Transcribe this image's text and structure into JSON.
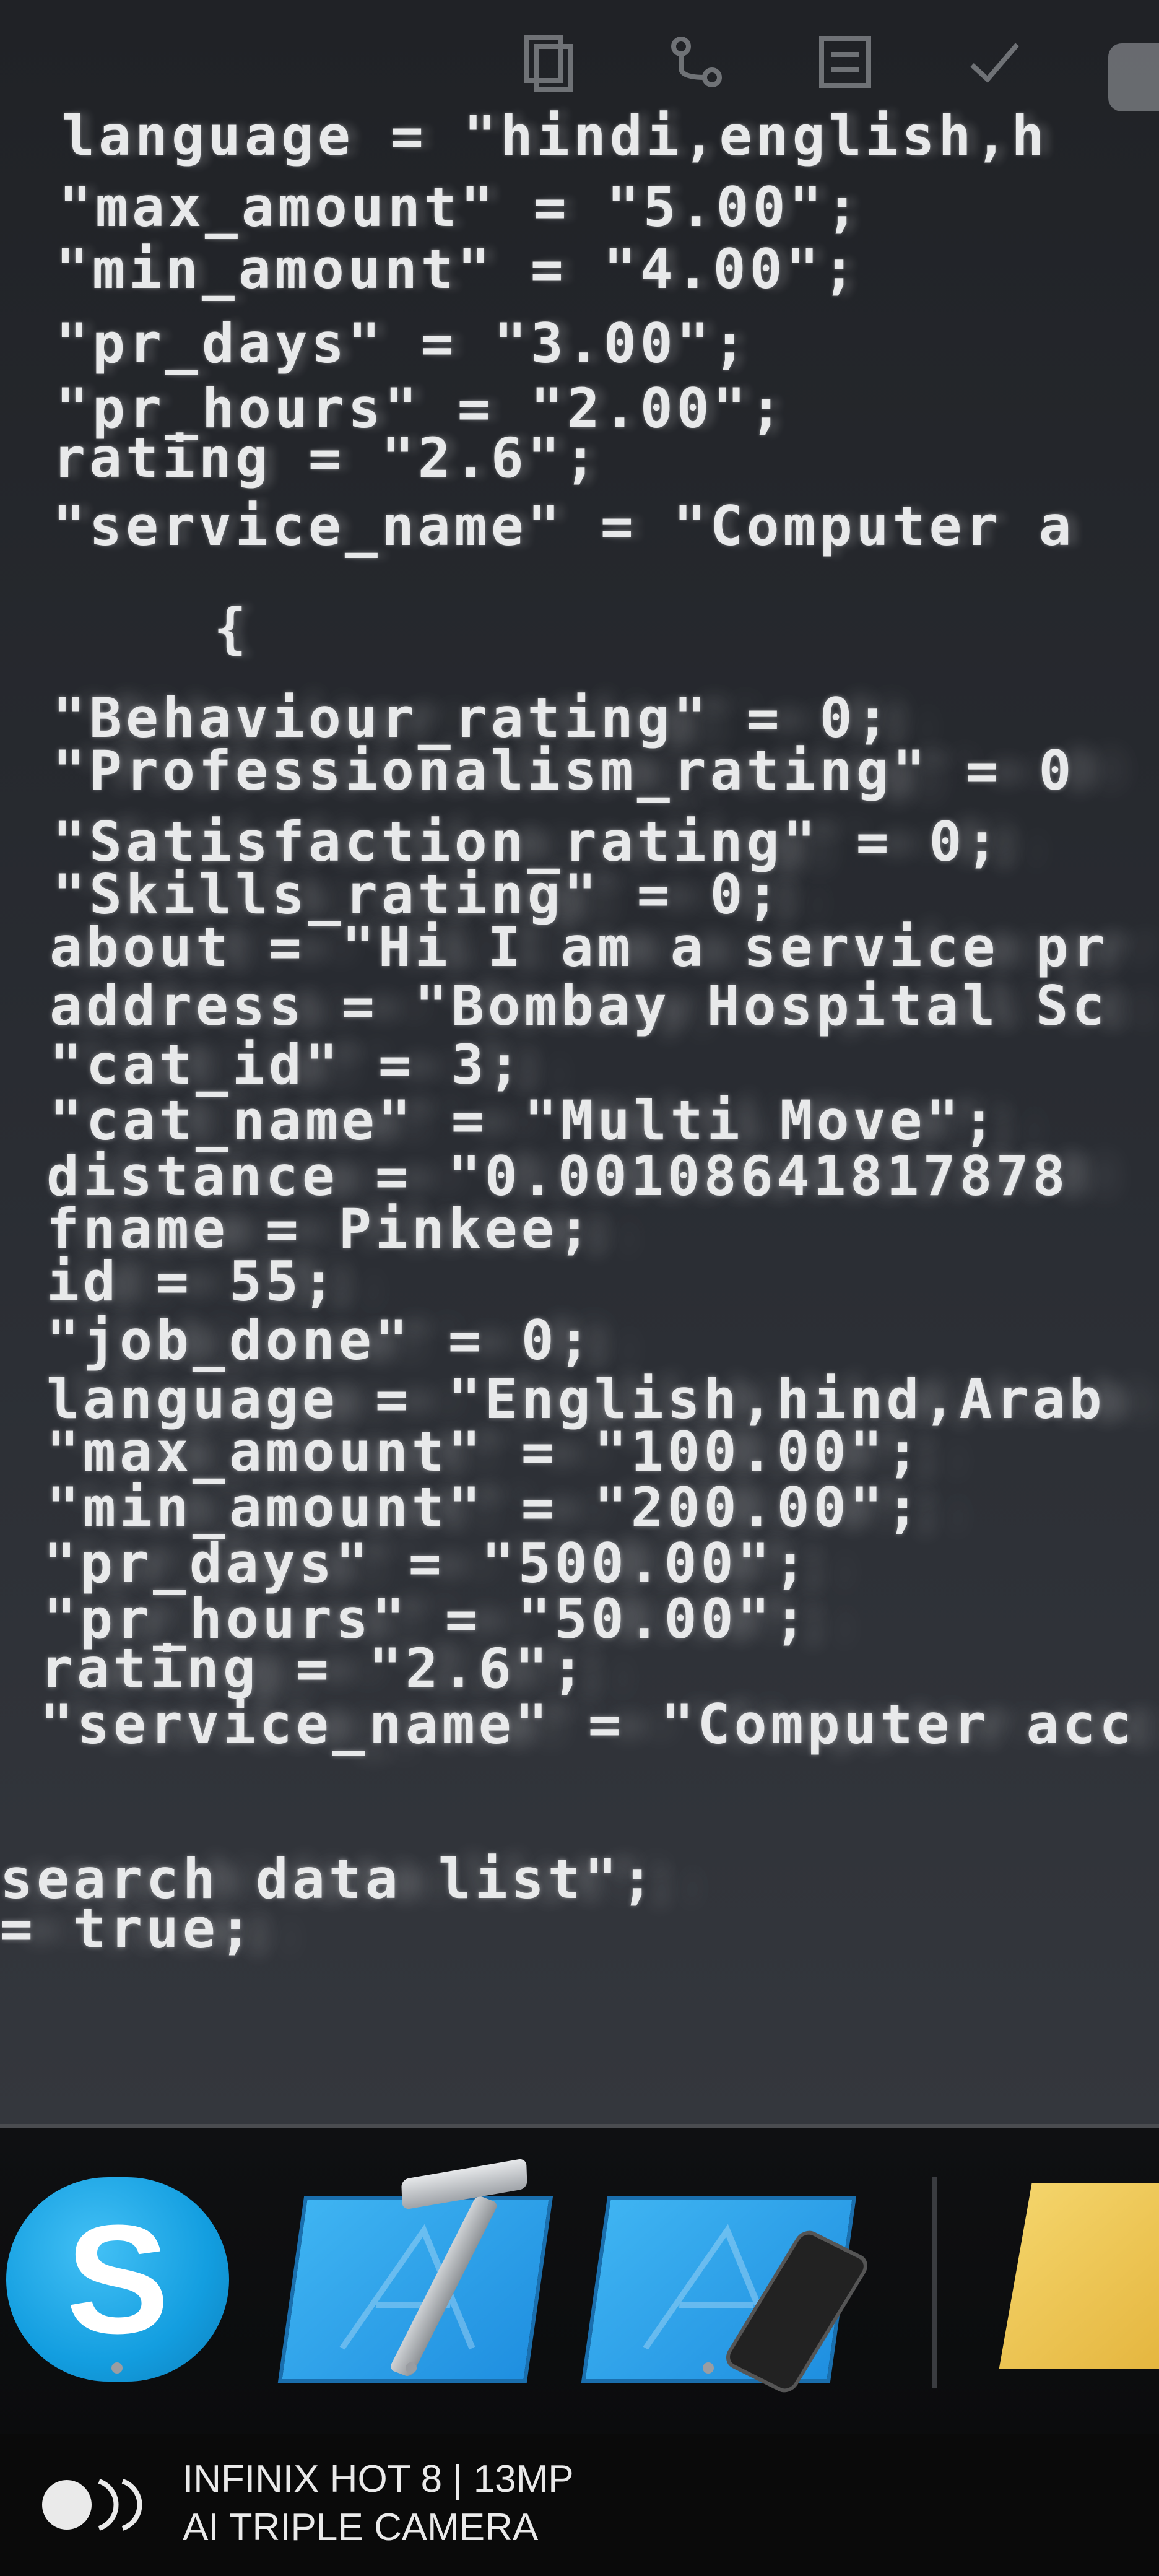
{
  "console": {
    "lines": [
      "language = \"hindi,english,h",
      "\"max_amount\" = \"5.00\";",
      "\"min_amount\" = \"4.00\";",
      "\"pr_days\" = \"3.00\";",
      "\"pr_hours\" = \"2.00\";",
      "rating = \"2.6\";",
      "\"service_name\" = \"Computer a",
      "{",
      "\"Behaviour_rating\" = 0;",
      "\"Professionalism_rating\" = 0",
      "\"Satisfaction_rating\" = 0;",
      "\"Skills_rating\" = 0;",
      "about = \"Hi I am a service pr",
      "address = \"Bombay Hospital Sc",
      "\"cat_id\" = 3;",
      "\"cat_name\" = \"Multi Move\";",
      "distance = \"0.00108641817878",
      "fname = Pinkee;",
      "id = 55;",
      "\"job_done\" = 0;",
      "language = \"English,hind,Arab",
      "\"max_amount\" = \"100.00\";",
      "\"min_amount\" = \"200.00\";",
      "\"pr_days\" = \"500.00\";",
      "\"pr_hours\" = \"50.00\";",
      "rating = \"2.6\";",
      "\"service_name\" = \"Computer acc",
      "search data list\";",
      "= true;"
    ]
  },
  "dock": {
    "skype_label": "S",
    "icons": [
      "skype-icon",
      "xcode-icon",
      "simulator-icon",
      "notes-icon"
    ]
  },
  "watermark": {
    "line1": "INFINIX HOT 8 | 13MP",
    "line2": "AI TRIPLE CAMERA"
  },
  "colors": {
    "console_bg": "#23252a",
    "code_text": "#e8e9ea",
    "skype_blue": "#139ee0",
    "xcode_blue": "#1f8fe0"
  }
}
